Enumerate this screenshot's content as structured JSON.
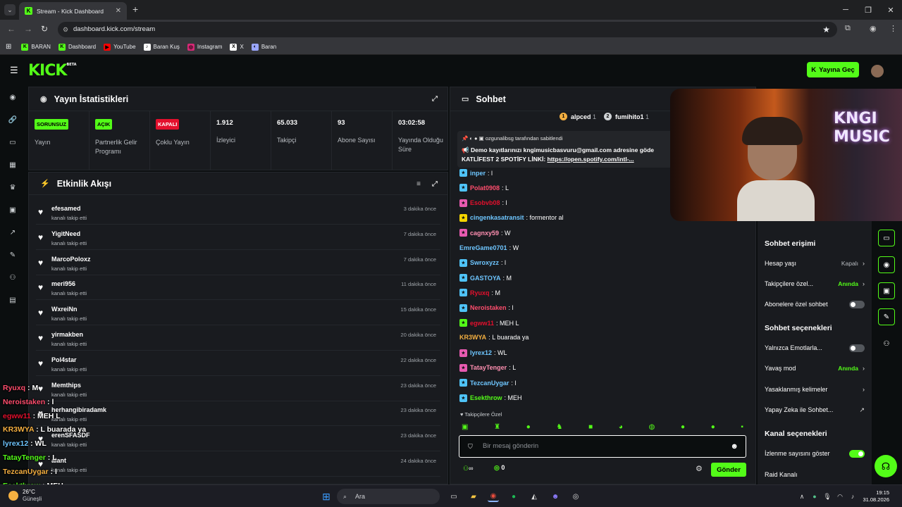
{
  "browser": {
    "tab_title": "Stream - Kick Dashboard",
    "url": "dashboard.kick.com/stream",
    "bookmarks": [
      {
        "label": "BARAN",
        "color": "#53fc18",
        "glyph": "K"
      },
      {
        "label": "Dashboard",
        "color": "#53fc18",
        "glyph": "K"
      },
      {
        "label": "YouTube",
        "color": "#ff0000",
        "glyph": "▶"
      },
      {
        "label": "Baran Kuş",
        "color": "#ffffff",
        "glyph": "♪"
      },
      {
        "label": "Instagram",
        "color": "#d62976",
        "glyph": "◎"
      },
      {
        "label": "X",
        "color": "#ffffff",
        "glyph": "X"
      },
      {
        "label": "Baran",
        "color": "#9aa6ff",
        "glyph": "◐"
      }
    ]
  },
  "header": {
    "logo": "KICK",
    "logo_badge": "BETA",
    "go_live": "Yayına Geç"
  },
  "stats": {
    "title": "Yayın İstatistikleri",
    "cells": [
      {
        "badge": "SORUNSUZ",
        "badge_color": "#53fc18",
        "label": "Yayın"
      },
      {
        "badge": "AÇIK",
        "badge_color": "#53fc18",
        "label": "Partnerlik Gelir Programı"
      },
      {
        "badge": "KAPALI",
        "badge_color": "#e3102d",
        "label": "Çoklu Yayın"
      },
      {
        "value": "1.912",
        "label": "İzleyici"
      },
      {
        "value": "65.033",
        "label": "Takipçi"
      },
      {
        "value": "93",
        "label": "Abone Sayısı"
      },
      {
        "value": "03:02:58",
        "label": "Yayında Olduğu Süre"
      }
    ]
  },
  "feed": {
    "title": "Etkinlik Akışı",
    "items": [
      {
        "user": "efesamed",
        "action": "kanalı takip etti",
        "time": "3 dakika önce"
      },
      {
        "user": "YigitNeed",
        "action": "kanalı takip etti",
        "time": "7 dakika önce"
      },
      {
        "user": "MarcoPoloxz",
        "action": "kanalı takip etti",
        "time": "7 dakika önce"
      },
      {
        "user": "meri956",
        "action": "kanalı takip etti",
        "time": "11 dakika önce"
      },
      {
        "user": "WxreiNn",
        "action": "kanalı takip etti",
        "time": "15 dakika önce"
      },
      {
        "user": "yirmakben",
        "action": "kanalı takip etti",
        "time": "20 dakika önce"
      },
      {
        "user": "Pol4star",
        "action": "kanalı takip etti",
        "time": "22 dakika önce"
      },
      {
        "user": "Memthips",
        "action": "kanalı takip etti",
        "time": "23 dakika önce"
      },
      {
        "user": "herhangibiradamk",
        "action": "kanalı takip etti",
        "time": "23 dakika önce"
      },
      {
        "user": "erenSFASDF",
        "action": "kanalı takip etti",
        "time": "23 dakika önce"
      },
      {
        "user": "alant",
        "action": "kanalı takip etti",
        "time": "24 dakika önce"
      }
    ]
  },
  "overlay": [
    {
      "name": "Ryuxq",
      "color": "#ff4d6d",
      "text": "M"
    },
    {
      "name": "Neroistaken",
      "color": "#ff4d6d",
      "text": "l"
    },
    {
      "name": "egww11",
      "color": "#e3102d",
      "text": "MEH L"
    },
    {
      "name": "KR3WYA",
      "color": "#f5b041",
      "text": "L buarada ya"
    },
    {
      "name": "lyrex12",
      "color": "#6ec6ff",
      "text": "WL"
    },
    {
      "name": "TatayTenger",
      "color": "#53fc18",
      "text": "L"
    },
    {
      "name": "TezcanUygar",
      "color": "#f5b041",
      "text": "l"
    },
    {
      "name": "Esekthrow",
      "color": "#53fc18",
      "text": "MEH"
    }
  ],
  "chat": {
    "title": "Sohbet",
    "leaders": [
      {
        "name": "alpced",
        "count": "1",
        "color": "#f5b041",
        "glyph": "1"
      },
      {
        "name": "fumihito1",
        "count": "1",
        "color": "#cfd3d6",
        "glyph": "2"
      }
    ],
    "pinned_by": "ozgunalibsg tarafından sabitlendi",
    "pinned_line1": "Demo kayıtlarınızı kngimusicbasvuru@gmail.com adresine göde",
    "pinned_line2_prefix": "KATLİFEST 2 SPOTİFY LİNKİ: ",
    "pinned_link": "https://open.spotify.com/intl-...",
    "messages": [
      {
        "name": "inper",
        "color": "#6ec6ff",
        "badge": "#4fc3f7",
        "text": "l"
      },
      {
        "name": "Polat0908",
        "color": "#ff4d6d",
        "badge": "#4fc3f7",
        "text": "L"
      },
      {
        "name": "Esobvb08",
        "color": "#e3102d",
        "badge": "#e75ab0",
        "text": "l"
      },
      {
        "name": "cingenkasatransit",
        "color": "#6ec6ff",
        "badge": "#f5d400",
        "text": "formentor al"
      },
      {
        "name": "cagnxy59",
        "color": "#ff8fb1",
        "badge": "#e75ab0",
        "text": "W"
      },
      {
        "name": "EmreGame0701",
        "color": "#6ec6ff",
        "badge": "",
        "text": "W"
      },
      {
        "name": "Swroxyzz",
        "color": "#6ec6ff",
        "badge": "#4fc3f7",
        "text": "l"
      },
      {
        "name": "GASTOYA",
        "color": "#6ec6ff",
        "badge": "#4fc3f7",
        "text": "M"
      },
      {
        "name": "Ryuxq",
        "color": "#e3102d",
        "badge": "#4fc3f7",
        "text": "M"
      },
      {
        "name": "Neroistaken",
        "color": "#ff4d6d",
        "badge": "#4fc3f7",
        "text": "l"
      },
      {
        "name": "egww11",
        "color": "#e3102d",
        "badge": "#53fc18",
        "text": "MEH L"
      },
      {
        "name": "KR3WYA",
        "color": "#f5b041",
        "badge": "",
        "text": "L buarada ya"
      },
      {
        "name": "lyrex12",
        "color": "#6ec6ff",
        "badge": "#e75ab0",
        "text": "WL"
      },
      {
        "name": "TatayTenger",
        "color": "#ff8fb1",
        "badge": "#e75ab0",
        "text": "L"
      },
      {
        "name": "TezcanUygar",
        "color": "#6ec6ff",
        "badge": "#4fc3f7",
        "text": "l"
      },
      {
        "name": "Esekthrow",
        "color": "#53fc18",
        "badge": "#4fc3f7",
        "text": "MEH"
      }
    ],
    "followers_only": "Takipçilere Özel",
    "input_placeholder": "Bir mesaj gönderin",
    "points": "0",
    "send": "Gönder"
  },
  "settings": {
    "access_title": "Sohbet erişimi",
    "account_age": {
      "label": "Hesap yaşı",
      "value": "Kapalı"
    },
    "followers_only": {
      "label": "Takipçilere özel...",
      "value": "Anında"
    },
    "subs_only": {
      "label": "Abonelere özel sohbet",
      "on": false
    },
    "options_title": "Sohbet seçenekleri",
    "emotes_only": {
      "label": "Yalnızca Emotlarla...",
      "on": false
    },
    "slow_mode": {
      "label": "Yavaş mod",
      "value": "Anında"
    },
    "banned_words": "Yasaklanmış kelimeler",
    "ai_chat": "Yapay Zeka ile Sohbet...",
    "channel_title": "Kanal seçenekleri",
    "show_viewers": {
      "label": "İzlenme sayısını göster",
      "on": true
    },
    "raid": "Raid Kanalı"
  },
  "taskbar": {
    "weather_temp": "26°C",
    "weather_city": "Güneşli",
    "search": "Ara",
    "time": "19:15",
    "date": "31.08.2026"
  },
  "colors": {
    "accent": "#53fc18",
    "danger": "#e3102d"
  }
}
